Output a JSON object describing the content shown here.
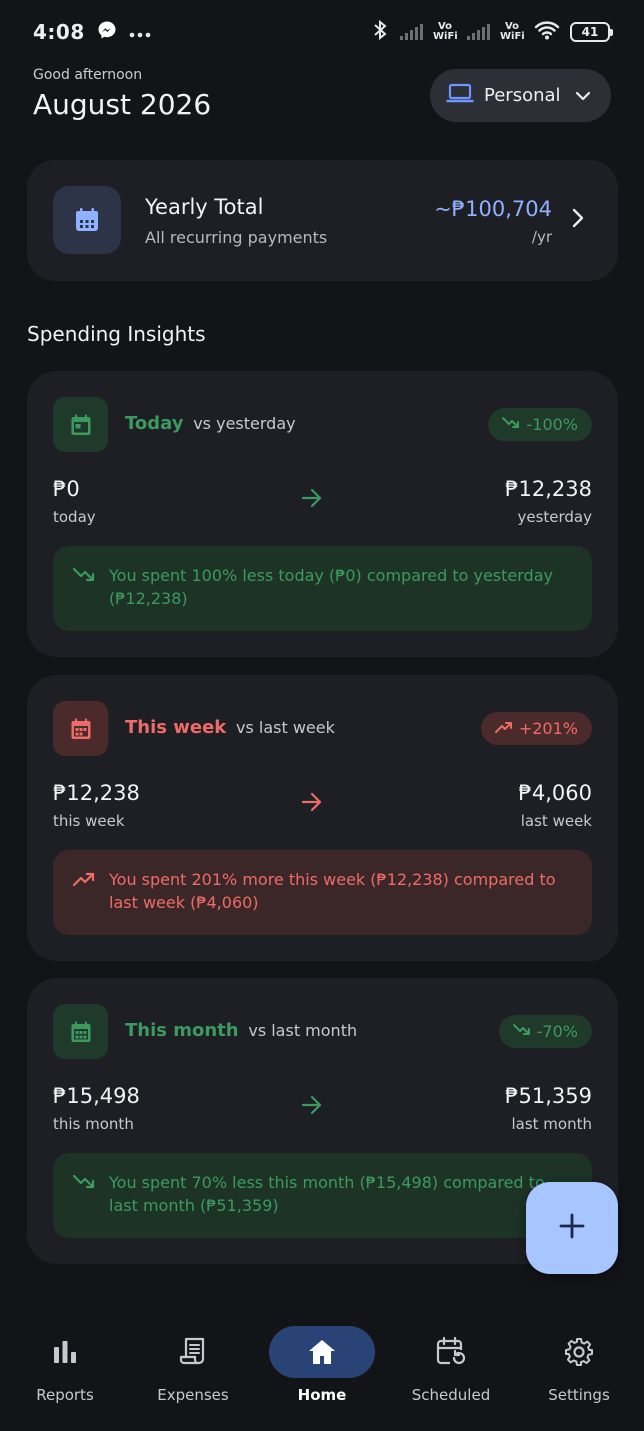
{
  "status_bar": {
    "time": "4:08",
    "vowifi_1": "Vo WiFi",
    "vowifi_2": "Vo WiFi",
    "battery": "41"
  },
  "header": {
    "greeting": "Good afternoon",
    "title": "August 2026",
    "profile_label": "Personal"
  },
  "yearly": {
    "title": "Yearly Total",
    "subtitle": "All recurring payments",
    "amount": "~₱100,704",
    "unit": "/yr"
  },
  "section_title": "Spending Insights",
  "insights": [
    {
      "period": "Today",
      "vs": "vs yesterday",
      "badge": "-100%",
      "current_value": "₱0",
      "current_label": "today",
      "previous_value": "₱12,238",
      "previous_label": "yesterday",
      "note": "You spent 100% less today (₱0) compared to yesterday (₱12,238)",
      "trend": "down",
      "color": "#3d9a5f"
    },
    {
      "period": "This week",
      "vs": "vs last week",
      "badge": "+201%",
      "current_value": "₱12,238",
      "current_label": "this week",
      "previous_value": "₱4,060",
      "previous_label": "last week",
      "note": "You spent 201% more this week (₱12,238) compared to last week (₱4,060)",
      "trend": "up",
      "color": "#ef6b67"
    },
    {
      "period": "This month",
      "vs": "vs last month",
      "badge": "-70%",
      "current_value": "₱15,498",
      "current_label": "this month",
      "previous_value": "₱51,359",
      "previous_label": "last month",
      "note": "You spent 70% less this month (₱15,498) compared to last month (₱51,359)",
      "trend": "down",
      "color": "#3d9a5f"
    }
  ],
  "nav": {
    "reports": "Reports",
    "expenses": "Expenses",
    "home": "Home",
    "scheduled": "Scheduled",
    "settings": "Settings"
  },
  "colors": {
    "background": "#131417",
    "card": "#1d1f24",
    "accent_blue": "#8fb1ff",
    "fab": "#a7c5ff",
    "green": "#3d9a5f",
    "red": "#ef6b67"
  }
}
